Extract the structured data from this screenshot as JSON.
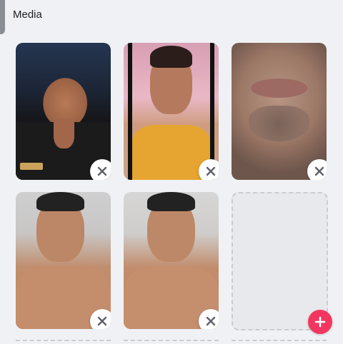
{
  "header": {
    "title": "Media"
  },
  "tiles": [
    {
      "name": "media-photo-1",
      "remove_icon": "close-icon"
    },
    {
      "name": "media-photo-2",
      "remove_icon": "close-icon"
    },
    {
      "name": "media-photo-3",
      "remove_icon": "close-icon"
    },
    {
      "name": "media-photo-4",
      "remove_icon": "close-icon"
    },
    {
      "name": "media-photo-5",
      "remove_icon": "close-icon"
    }
  ],
  "empty_slot": {
    "add_icon": "plus-icon"
  },
  "colors": {
    "accent": "#f3365f",
    "background": "#f0f1f4",
    "dashed_border": "#cbccd1"
  }
}
